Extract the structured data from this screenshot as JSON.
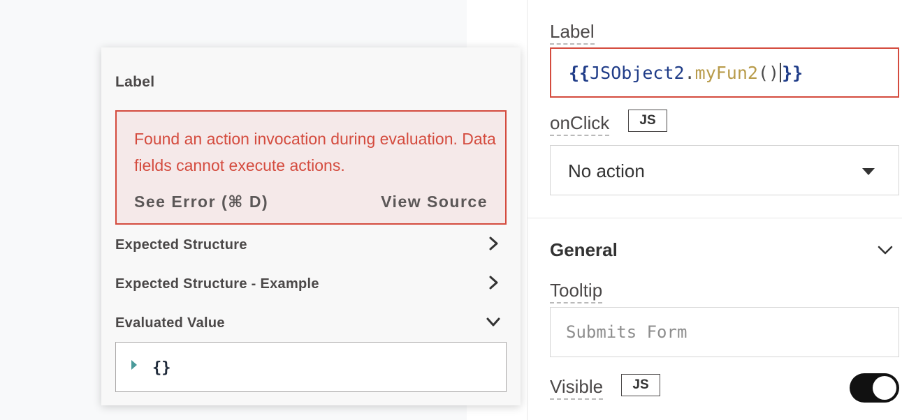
{
  "popup": {
    "title": "Label",
    "error": {
      "message": "Found an action invocation during evaluation. Data fields cannot execute actions.",
      "see_error": "See Error (⌘ D)",
      "view_source": "View Source"
    },
    "sections": [
      {
        "label": "Expected Structure",
        "state": "collapsed",
        "icon": "chevron-right-icon"
      },
      {
        "label": "Expected Structure - Example",
        "state": "collapsed",
        "icon": "chevron-right-icon"
      },
      {
        "label": "Evaluated Value",
        "state": "expanded",
        "icon": "chevron-down-icon"
      }
    ],
    "evaluated_value": "{}"
  },
  "properties": {
    "label": {
      "title": "Label",
      "code": {
        "open": "{{",
        "object": "JSObject2",
        "dot": ".",
        "fn": "myFun2",
        "parens": "()",
        "close": "}}"
      }
    },
    "onclick": {
      "title": "onClick",
      "js_badge": "JS",
      "value": "No action"
    },
    "general": {
      "title": "General",
      "tooltip": {
        "title": "Tooltip",
        "placeholder": "Submits Form"
      },
      "visible": {
        "title": "Visible",
        "js_badge": "JS",
        "enabled": true
      }
    }
  },
  "colors": {
    "error": "#d44b3e",
    "error_bg": "#f5e9e9",
    "code_brace": "#1f3c88",
    "code_fn": "#b89b4a",
    "toggle_on": "#111111"
  }
}
